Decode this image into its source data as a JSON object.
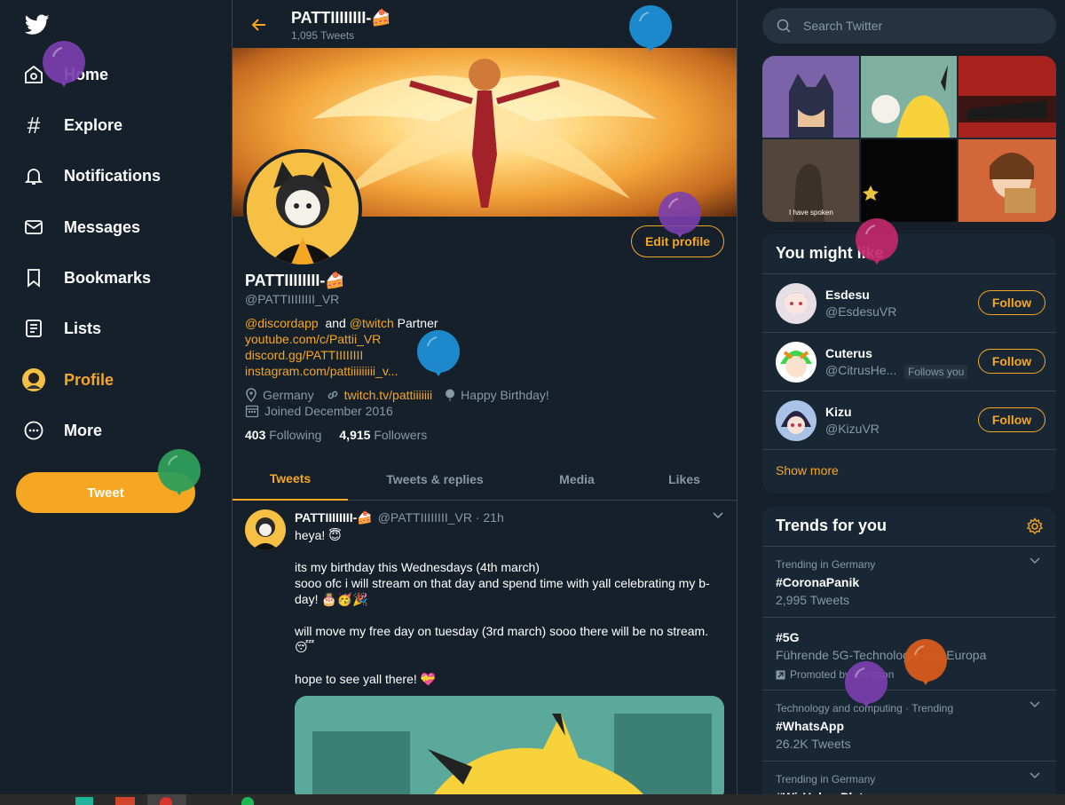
{
  "nav": {
    "items": [
      {
        "label": "Home",
        "icon": "home-icon"
      },
      {
        "label": "Explore",
        "icon": "hashtag-icon"
      },
      {
        "label": "Notifications",
        "icon": "bell-icon"
      },
      {
        "label": "Messages",
        "icon": "envelope-icon"
      },
      {
        "label": "Bookmarks",
        "icon": "bookmark-icon"
      },
      {
        "label": "Lists",
        "icon": "list-icon"
      },
      {
        "label": "Profile",
        "icon": "profile-avatar-icon"
      },
      {
        "label": "More",
        "icon": "more-dots-icon"
      }
    ],
    "tweet_button": "Tweet"
  },
  "header": {
    "name": "PATTIIIIIIII-🍰",
    "tweet_count": "1,095 Tweets"
  },
  "profile": {
    "edit_button": "Edit profile",
    "name": "PATTIIIIIIII-🍰",
    "handle": "@PATTIIIIIIII_VR",
    "bio_mention1": "@discordapp",
    "bio_and": "and",
    "bio_mention2": "@twitch",
    "bio_partner": "Partner",
    "links": [
      "youtube.com/c/Pattii_VR",
      "discord.gg/PATTIIIIIIII",
      "instagram.com/pattiiiiiiiii_v..."
    ],
    "location": "Germany",
    "website": "twitch.tv/pattiiiiiii",
    "birthday": "Happy Birthday!",
    "joined": "Joined December 2016",
    "following_count": "403",
    "following_label": "Following",
    "followers_count": "4,915",
    "followers_label": "Followers"
  },
  "tabs": [
    "Tweets",
    "Tweets & replies",
    "Media",
    "Likes"
  ],
  "tweet": {
    "name": "PATTIIIIIIII-🍰",
    "meta": "@PATTIIIIIIII_VR · 21h",
    "line1": "heya! 😇",
    "line2": "its my birthday this Wednesdays (4th march)",
    "line3": " sooo ofc i will stream on that day and spend time with yall celebrating my b-day! 🎂🥳🎉",
    "line4": "will move my free day on tuesday (3rd march) sooo there will be no stream. 😴",
    "line5": "hope to see yall there! 💝"
  },
  "search": {
    "placeholder": "Search Twitter"
  },
  "media_grid": {
    "caption": "I have spoken"
  },
  "might_like": {
    "title": "You might like",
    "users": [
      {
        "name": "Esdesu",
        "handle": "@EsdesuVR",
        "follows_you": "",
        "button": "Follow"
      },
      {
        "name": "Cuterus",
        "handle": "@CitrusHe...",
        "follows_you": "Follows you",
        "button": "Follow"
      },
      {
        "name": "Kizu",
        "handle": "@KizuVR",
        "follows_you": "",
        "button": "Follow"
      }
    ],
    "show_more": "Show more"
  },
  "trends": {
    "title": "Trends for you",
    "items": [
      {
        "context": "Trending in Germany",
        "name": "#CoronaPanik",
        "count": "2,995 Tweets"
      },
      {
        "context": "",
        "name": "#5G",
        "count": "Führende 5G-Technologie aus Europa",
        "promoted": "Promoted by Ericsson"
      },
      {
        "context": "Technology and computing · Trending",
        "name": "#WhatsApp",
        "count": "26.2K Tweets"
      },
      {
        "context": "Trending in Germany",
        "name": "#WirHabenPlatz",
        "count": ""
      }
    ]
  },
  "colors": {
    "accent": "#f5a623",
    "background": "#15202b",
    "card": "#192734",
    "border": "#38444d",
    "muted": "#8899a6"
  }
}
